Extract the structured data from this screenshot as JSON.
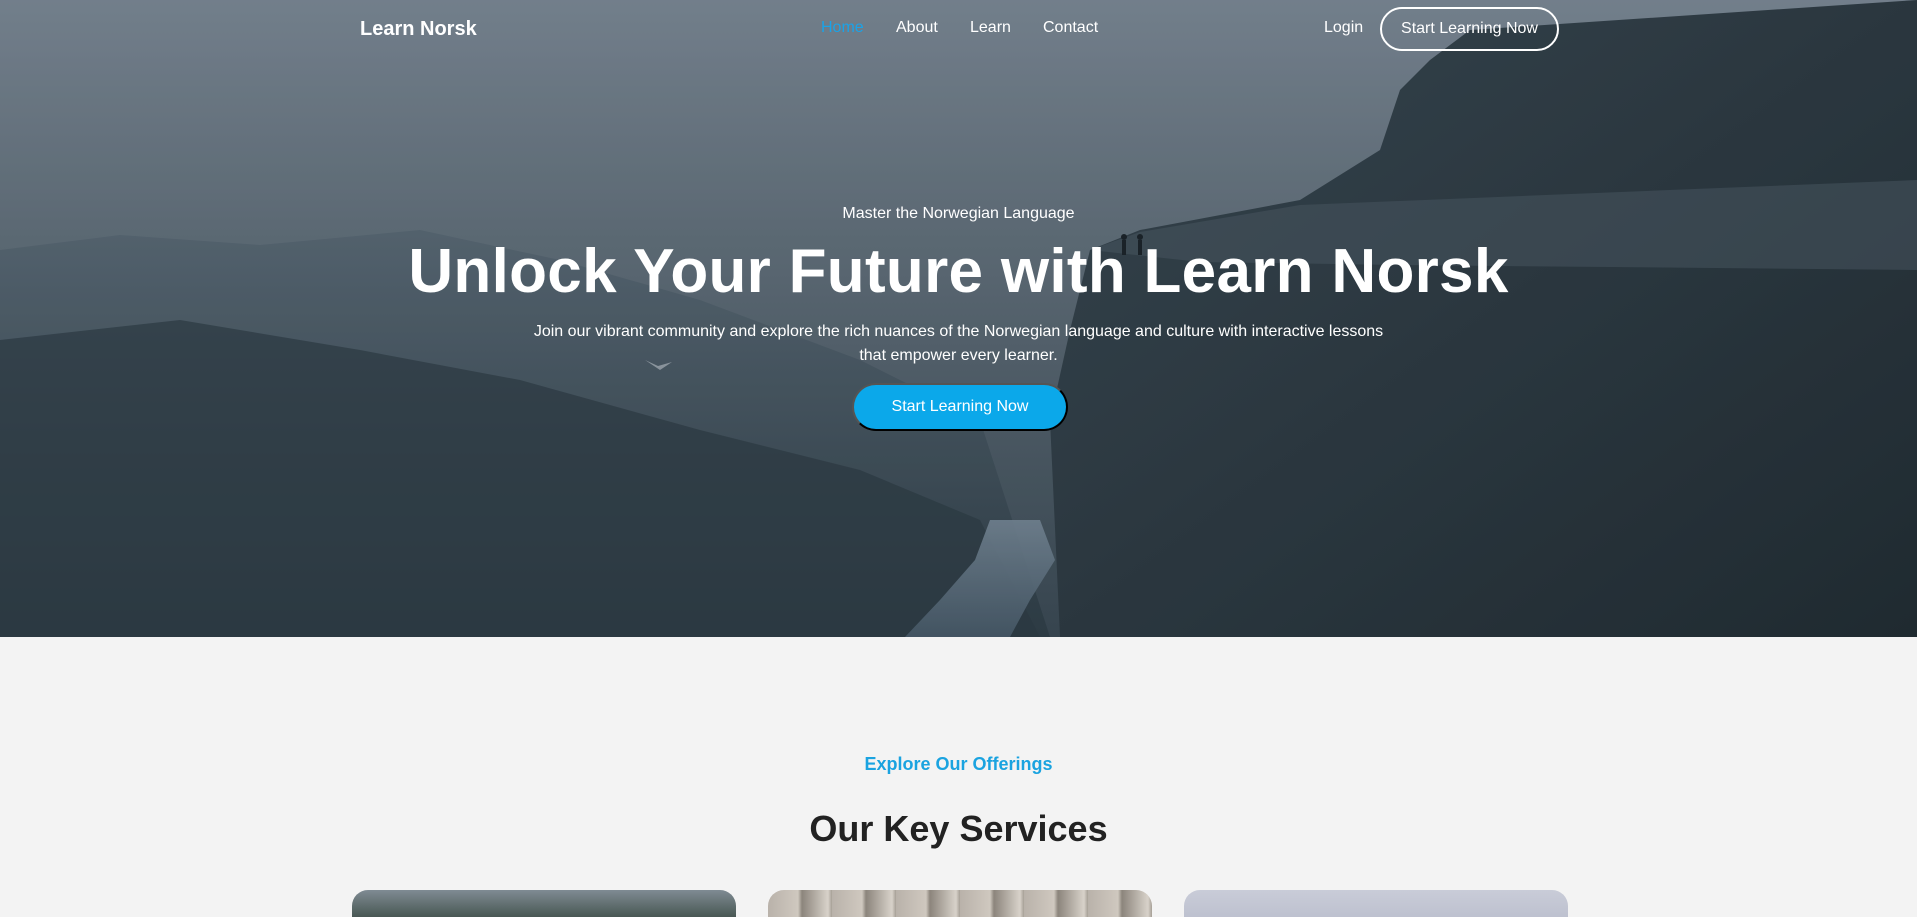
{
  "header": {
    "logo": "Learn Norsk",
    "nav": [
      {
        "label": "Home",
        "active": true
      },
      {
        "label": "About",
        "active": false
      },
      {
        "label": "Learn",
        "active": false
      },
      {
        "label": "Contact",
        "active": false
      }
    ],
    "login_label": "Login",
    "cta_label": "Start Learning Now"
  },
  "hero": {
    "eyebrow": "Master the Norwegian Language",
    "title": "Unlock Your Future with Learn Norsk",
    "description": "Join our vibrant community and explore the rich nuances of the Norwegian language and culture with interactive lessons that empower every learner.",
    "cta_label": "Start Learning Now"
  },
  "services": {
    "eyebrow": "Explore Our Offerings",
    "title": "Our Key Services"
  },
  "colors": {
    "accent": "#0ba8ea",
    "nav_active": "#1aa3e8",
    "page_bg": "#f3f3f3",
    "heading": "#222222"
  }
}
